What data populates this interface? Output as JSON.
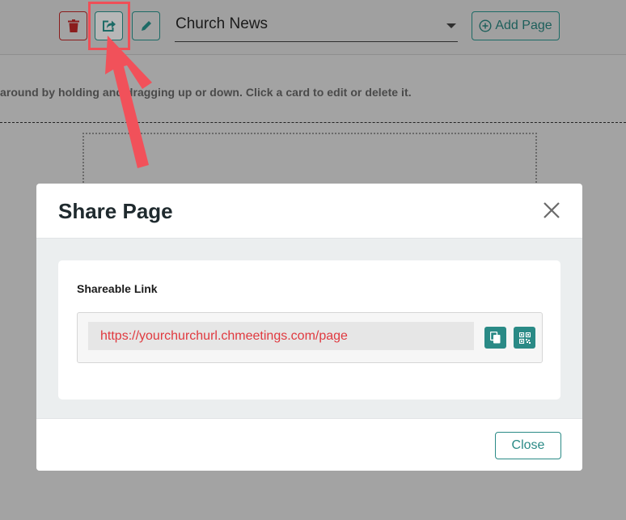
{
  "toolbar": {
    "delete_icon": "trash-icon",
    "share_icon": "share-icon",
    "edit_icon": "pencil-icon",
    "page_select_value": "Church News",
    "add_page_label": "Add Page",
    "add_page_icon": "plus-circle-icon"
  },
  "main": {
    "hint_text": "around by holding and dragging up or down. Click a card to edit or delete it."
  },
  "modal": {
    "title": "Share Page",
    "close_icon": "close-icon",
    "shareable_label": "Shareable Link",
    "link_url": "https://yourchurchurl.chmeetings.com/page",
    "copy_icon": "copy-icon",
    "qr_icon": "qr-code-icon",
    "close_button_label": "Close"
  },
  "colors": {
    "accent": "#2a8a86",
    "danger": "#8b1d1d",
    "link_text": "#e0393f",
    "highlight": "#ef4f57",
    "overlay": "#a3a3a3"
  }
}
